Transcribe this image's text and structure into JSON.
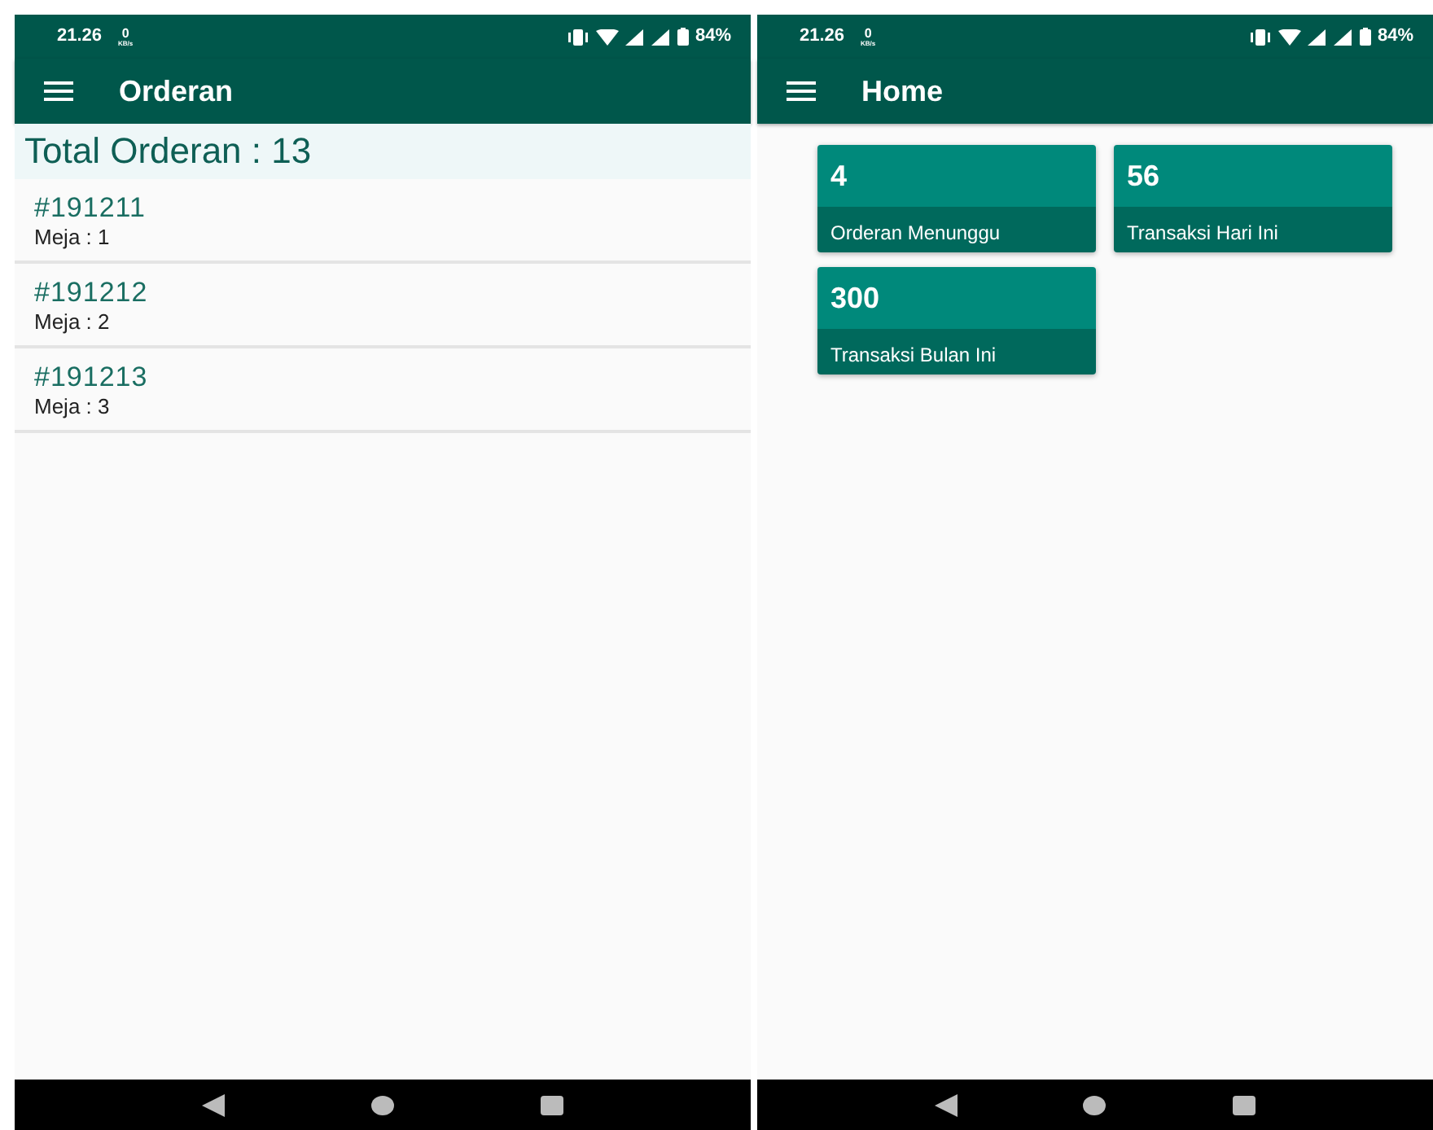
{
  "screens": [
    {
      "kind": "orders",
      "status_bar": {
        "time": "21.26",
        "speed_value": "0",
        "speed_unit": "KB/s",
        "battery": "84%"
      },
      "title": "Orderan",
      "total": "Total Orderan : 13",
      "orders": [
        {
          "number": "#191211",
          "table": "Meja : 1"
        },
        {
          "number": "#191212",
          "table": "Meja : 2"
        },
        {
          "number": "#191213",
          "table": "Meja : 3"
        }
      ]
    },
    {
      "kind": "dashboard",
      "status_bar": {
        "time": "21.26",
        "speed_value": "0",
        "speed_unit": "KB/s",
        "battery": "84%"
      },
      "title": "Home",
      "tiles": [
        {
          "value": "4",
          "label": "Orderan Menunggu"
        },
        {
          "value": "56",
          "label": "Transaksi Hari Ini"
        },
        {
          "value": "300",
          "label": "Transaksi Bulan Ini"
        }
      ]
    }
  ]
}
